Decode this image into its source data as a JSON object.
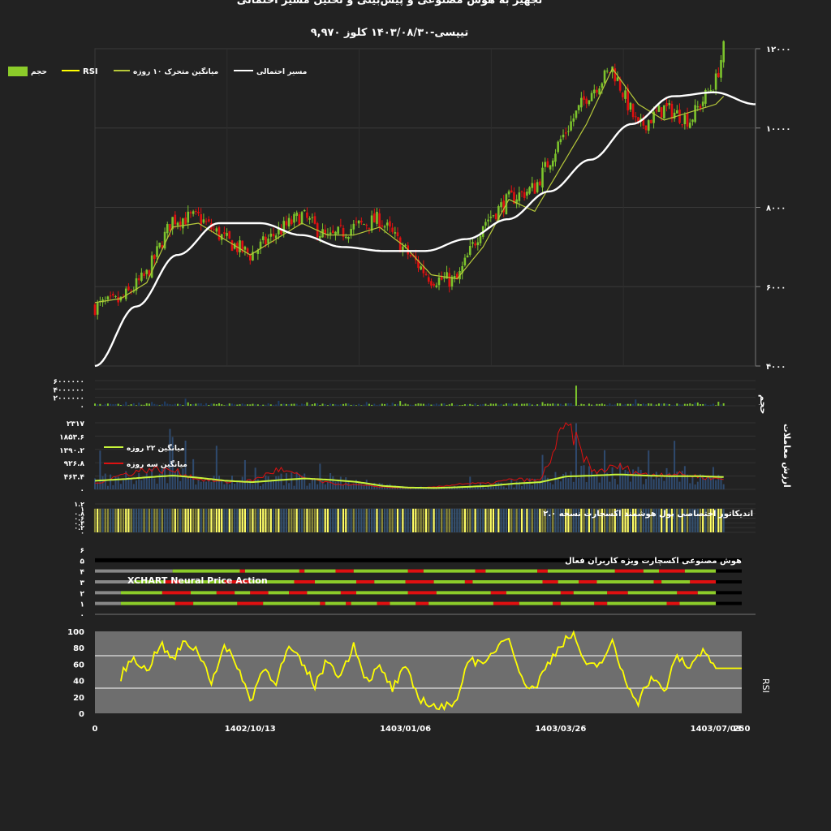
{
  "header": {
    "title": "تجهیز به هوش مصنوعی و پیش‌بینی و تحلیل مسیر احتمالی",
    "subtitle": "تیپسی-۱۴۰۳/۰۸/۳۰ کلوز ۹,۹۷۰"
  },
  "legend": {
    "volume": "حجم",
    "rsi": "RSI",
    "ma10": "میانگین متحرک ۱۰ روزه",
    "path": "مسیر احتمالی"
  },
  "colors": {
    "background": "#222222",
    "up": "#7cc42c",
    "down": "#e01010",
    "ma10": "#b7c93a",
    "path": "#ffffff",
    "volume": "#7cc42c",
    "value_bars": "#2f4a6e",
    "ma22": "#c8f53a",
    "ma3": "#dd1111",
    "rsi": "#ffff00",
    "smart_money_bar": "#ffff66",
    "ai_green": "#8ccc2a",
    "ai_red": "#e01010",
    "ai_gray": "#888888"
  },
  "panels": {
    "price": {
      "y_ticks": [
        "۴۰۰۰",
        "۶۰۰۰",
        "۸۰۰۰",
        "۱۰۰۰۰",
        "۱۲۰۰۰"
      ]
    },
    "volume": {
      "label": "حجم",
      "y_ticks": [
        "۰",
        "۲۰۰۰۰۰۰",
        "۴۰۰۰۰۰۰",
        "۶۰۰۰۰۰۰"
      ]
    },
    "value": {
      "label": "ارزش معاملات",
      "y_ticks": [
        "۰",
        "۴۶۳.۴",
        "۹۲۶.۸",
        "۱۳۹۰.۲",
        "۱۸۵۳.۶",
        "۲۳۱۷"
      ],
      "ma22_label": "میانگین ۲۲ روزه",
      "ma3_label": "میانگین سه روزه"
    },
    "smart_money": {
      "label": "اندیکاتور اختصاصی پول هوشمند اکسچارت نسخه ۲.۰",
      "y_ticks": [
        "۰",
        "۰.۲",
        "۰.۴",
        "۰.۶",
        "۰.۸",
        "۱",
        "۱.۲"
      ]
    },
    "ai": {
      "title": "هوش مصنوعی اکسچارت ویژه کاربران فعال",
      "subtitle": "XCHART Neural Price Action",
      "y_ticks": [
        "۰",
        "۱",
        "۲",
        "۳",
        "۴",
        "۵",
        "۶"
      ]
    },
    "rsi": {
      "label": "RSI",
      "y_ticks": [
        "0",
        "20",
        "40",
        "60",
        "80",
        "100"
      ]
    },
    "x_axis": {
      "ticks": [
        "0",
        "1402/10/13",
        "1403/01/06",
        "1403/03/26",
        "1403/07/03",
        "250"
      ]
    }
  },
  "chart_data": [
    {
      "type": "line",
      "name": "price",
      "x": [
        0,
        10,
        20,
        30,
        40,
        50,
        60,
        70,
        80,
        90,
        100,
        110,
        120,
        130,
        140,
        150,
        160,
        170,
        180,
        190,
        200,
        210,
        220,
        230,
        240,
        243
      ],
      "series": [
        {
          "name": "قیمت",
          "values": [
            5500,
            5650,
            6300,
            7700,
            7750,
            7200,
            6800,
            7350,
            7800,
            7200,
            7500,
            7700,
            6900,
            6200,
            6150,
            7600,
            8200,
            8500,
            9700,
            10800,
            11500,
            10000,
            10500,
            10200,
            11200,
            12000
          ]
        },
        {
          "name": "میانگین متحرک ۱۰ روزه",
          "values": [
            5600,
            5700,
            6100,
            7500,
            7600,
            7200,
            6800,
            7200,
            7600,
            7300,
            7300,
            7500,
            7000,
            6300,
            6200,
            7000,
            8200,
            7900,
            9000,
            10100,
            11500,
            10600,
            10200,
            10400,
            10600,
            10800
          ]
        },
        {
          "name": "مسیر احتمالی",
          "values": [
            4000,
            5500,
            6800,
            7600,
            7600,
            7300,
            7000,
            6900,
            6900,
            7200,
            7700,
            8400,
            9200,
            10100,
            10800,
            10900,
            10600
          ]
        }
      ],
      "ylim": [
        4000,
        12000
      ],
      "xlim": [
        0,
        250
      ]
    },
    {
      "type": "bar",
      "name": "volume",
      "ylim": [
        0,
        6000000
      ],
      "typical_value": 300000,
      "peaks": [
        {
          "x": 186,
          "value": 4800000
        },
        {
          "x": 35,
          "value": 1700000
        },
        {
          "x": 209,
          "value": 1500000
        },
        {
          "x": 22,
          "value": 900000
        }
      ]
    },
    {
      "type": "bar",
      "name": "value",
      "ylim": [
        0,
        2317
      ],
      "series": [
        {
          "name": "میانگین ۲۲ روزه",
          "values": [
            300,
            350,
            420,
            480,
            400,
            300,
            250,
            320,
            380,
            330,
            260,
            120,
            60,
            50,
            80,
            120,
            200,
            250,
            450,
            480,
            520,
            480,
            460,
            460,
            430
          ]
        },
        {
          "name": "میانگین سه روزه",
          "values": [
            200,
            500,
            700,
            650,
            350,
            250,
            300,
            700,
            400,
            200,
            150,
            80,
            40,
            80,
            200,
            200,
            350,
            300,
            2300,
            600,
            800,
            500,
            550,
            450,
            350
          ]
        }
      ]
    },
    {
      "type": "line",
      "name": "RSI",
      "ylim": [
        0,
        100
      ],
      "bands": [
        30,
        70
      ],
      "x": [
        10,
        15,
        20,
        25,
        30,
        35,
        40,
        45,
        50,
        55,
        60,
        65,
        70,
        75,
        80,
        85,
        90,
        95,
        100,
        105,
        110,
        115,
        120,
        125,
        130,
        135,
        140,
        145,
        150,
        155,
        160,
        165,
        170,
        175,
        180,
        185,
        190,
        195,
        200,
        205,
        210,
        215,
        220,
        225,
        230,
        235,
        240,
        245,
        250
      ],
      "values": [
        45,
        70,
        50,
        85,
        65,
        88,
        75,
        40,
        80,
        60,
        15,
        55,
        40,
        80,
        60,
        35,
        65,
        45,
        85,
        40,
        55,
        30,
        55,
        20,
        10,
        5,
        20,
        70,
        55,
        80,
        97,
        40,
        30,
        60,
        85,
        98,
        55,
        60,
        85,
        40,
        15,
        45,
        25,
        70,
        55,
        80,
        55,
        55,
        55
      ]
    }
  ]
}
